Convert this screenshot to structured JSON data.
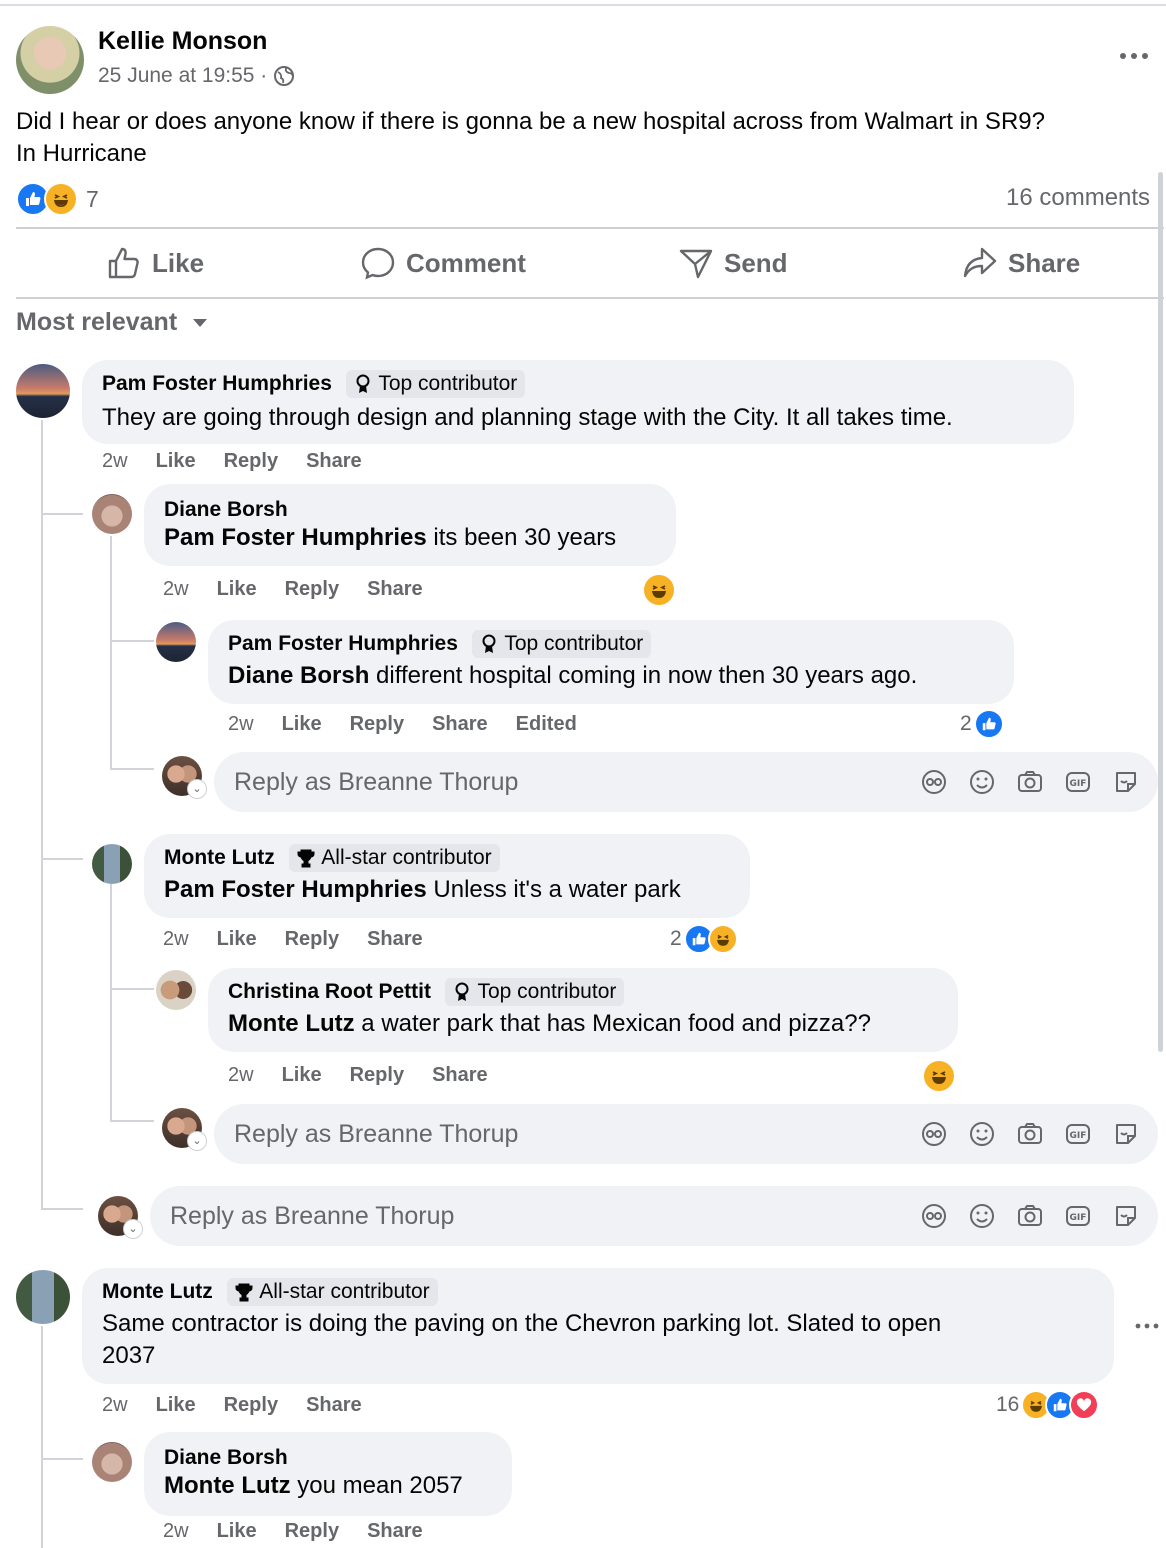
{
  "post": {
    "author": "Kellie Monson",
    "timestamp": "25 June at 19:55 ·",
    "text_line1": "Did I hear or does anyone know if there is gonna be a new hospital across from Walmart in SR9?",
    "text_line2": "In Hurricane",
    "reaction_count": "7",
    "comments_count": "16 comments",
    "more_icon": "more-horizontal-icon"
  },
  "actions": {
    "like": "Like",
    "comment": "Comment",
    "send": "Send",
    "share": "Share"
  },
  "sort_label": "Most relevant",
  "comment_actions": {
    "like": "Like",
    "reply": "Reply",
    "share": "Share",
    "edited": "Edited"
  },
  "reply_placeholder": "Reply as Breanne Thorup",
  "comments": [
    {
      "author": "Pam Foster Humphries",
      "badge": "Top contributor",
      "text": "They are going through design and planning stage with the City. It all takes time.",
      "age": "2w",
      "replies": [
        {
          "author": "Diane Borsh",
          "mention": "Pam Foster Humphries",
          "text": " its been 30 years",
          "age": "2w"
        },
        {
          "author": "Pam Foster Humphries",
          "badge": "Top contributor",
          "mention": "Diane Borsh",
          "text": " different hospital coming in now then 30 years ago.",
          "age": "2w",
          "reaction_count": "2"
        },
        {
          "author": "Monte Lutz",
          "badge": "All-star contributor",
          "mention": "Pam Foster Humphries",
          "text": " Unless it's a water park",
          "age": "2w",
          "reaction_count": "2"
        },
        {
          "author": "Christina Root Pettit",
          "badge": "Top contributor",
          "mention": "Monte Lutz",
          "text": " a water park that has Mexican food and pizza??",
          "age": "2w"
        }
      ]
    },
    {
      "author": "Monte Lutz",
      "badge": "All-star contributor",
      "text_line1": "Same contractor is doing the paving on the Chevron parking lot. Slated to open",
      "text_line2": "2037",
      "age": "2w",
      "reaction_count": "16",
      "replies": [
        {
          "author": "Diane Borsh",
          "mention": "Monte Lutz",
          "text": " you mean 2057",
          "age": "2w"
        }
      ]
    }
  ],
  "colors": {
    "like": "#1877f2",
    "haha": "#f7b125",
    "love": "#f33e58",
    "bubble": "#f0f2f5",
    "meta": "#65676b"
  }
}
